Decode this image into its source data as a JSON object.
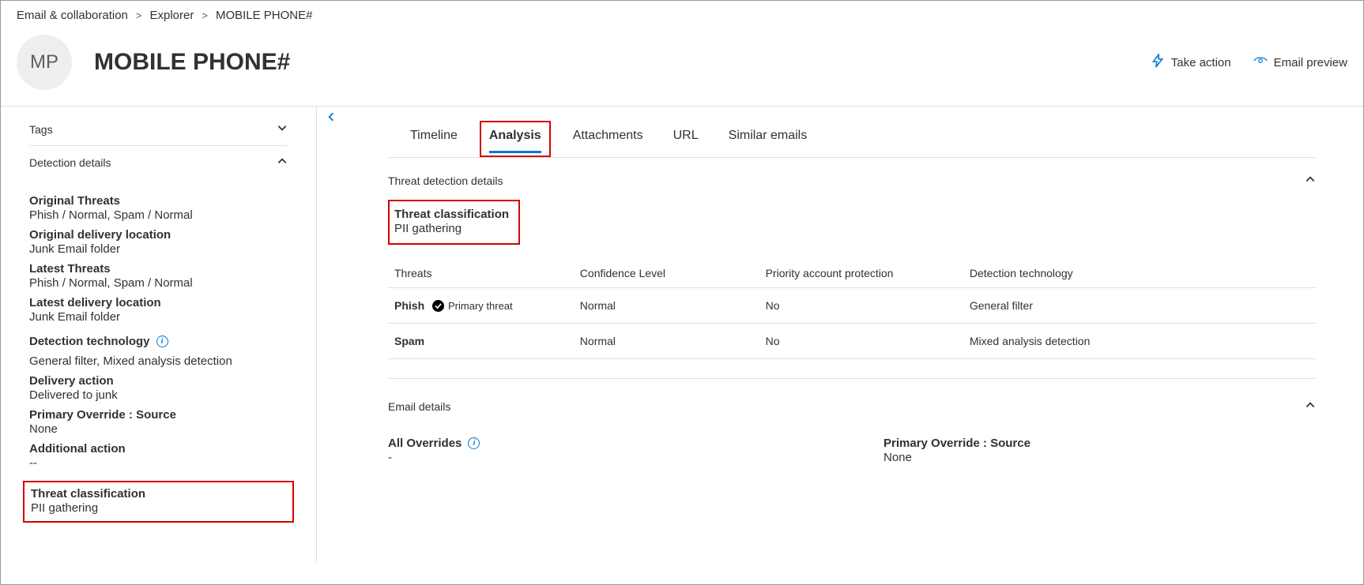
{
  "breadcrumb": [
    "Email & collaboration",
    "Explorer",
    "MOBILE PHONE#"
  ],
  "avatar_initials": "MP",
  "page_title": "MOBILE PHONE#",
  "actions": {
    "take_action": "Take action",
    "email_preview": "Email preview"
  },
  "left": {
    "tags_header": "Tags",
    "detection_header": "Detection details",
    "fields": {
      "original_threats_label": "Original Threats",
      "original_threats_value": "Phish / Normal, Spam / Normal",
      "original_delivery_location_label": "Original delivery location",
      "original_delivery_location_value": "Junk Email folder",
      "latest_threats_label": "Latest Threats",
      "latest_threats_value": "Phish / Normal, Spam / Normal",
      "latest_delivery_location_label": "Latest delivery location",
      "latest_delivery_location_value": "Junk Email folder",
      "detection_technology_label": "Detection technology",
      "detection_technology_value": "General filter, Mixed analysis detection",
      "delivery_action_label": "Delivery action",
      "delivery_action_value": "Delivered to junk",
      "primary_override_label": "Primary Override : Source",
      "primary_override_value": "None",
      "additional_action_label": "Additional action",
      "additional_action_value": "--",
      "threat_classification_label": "Threat classification",
      "threat_classification_value": "PII gathering"
    }
  },
  "tabs": [
    "Timeline",
    "Analysis",
    "Attachments",
    "URL",
    "Similar emails"
  ],
  "active_tab": "Analysis",
  "main": {
    "threat_detection_header": "Threat detection details",
    "threat_classification_label": "Threat classification",
    "threat_classification_value": "PII gathering",
    "table": {
      "headers": [
        "Threats",
        "Confidence Level",
        "Priority account protection",
        "Detection technology"
      ],
      "rows": [
        {
          "threat": "Phish",
          "primary": "Primary threat",
          "confidence": "Normal",
          "priority": "No",
          "tech": "General filter"
        },
        {
          "threat": "Spam",
          "primary": "",
          "confidence": "Normal",
          "priority": "No",
          "tech": "Mixed analysis detection"
        }
      ]
    },
    "email_details_header": "Email details",
    "all_overrides_label": "All Overrides",
    "all_overrides_value": "-",
    "primary_override_source_label": "Primary Override : Source",
    "primary_override_source_value": "None"
  }
}
